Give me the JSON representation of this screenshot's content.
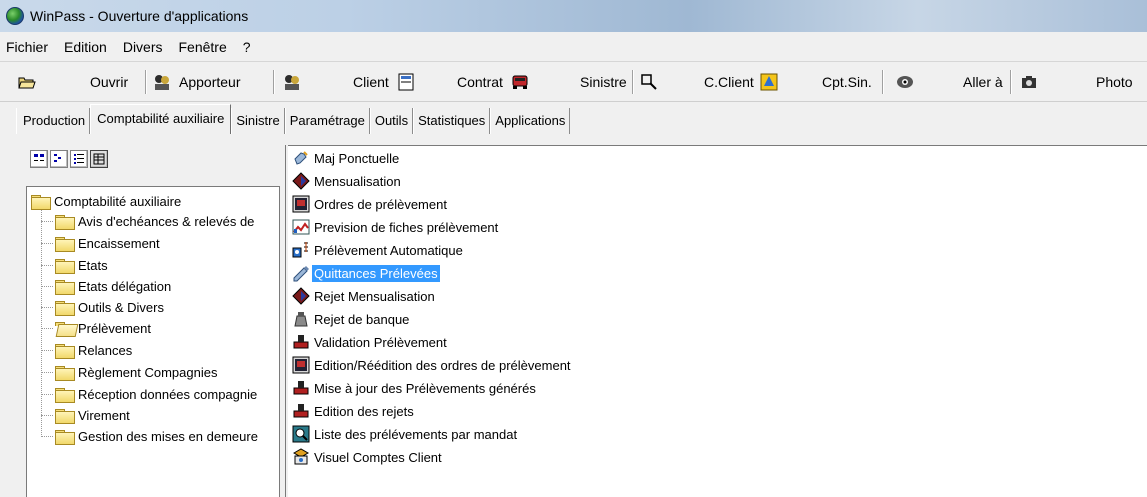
{
  "window": {
    "title": "WinPass - Ouverture d'applications"
  },
  "menu": [
    "Fichier",
    "Edition",
    "Divers",
    "Fenêtre",
    "?"
  ],
  "toolbar": {
    "ouvrir": "Ouvrir",
    "apporteur": "Apporteur",
    "client": "Client",
    "contrat": "Contrat",
    "sinistre": "Sinistre",
    "cclient": "C.Client",
    "cptsin": "Cpt.Sin.",
    "aller": "Aller à",
    "photo": "Photo"
  },
  "tabs": [
    "Production",
    "Comptabilité auxiliaire",
    "Sinistre",
    "Paramétrage",
    "Outils",
    "Statistiques",
    "Applications"
  ],
  "active_tab": "Comptabilité auxiliaire",
  "tree": {
    "root": "Comptabilité auxiliaire",
    "items": [
      "Avis d'echéances & relevés de",
      "Encaissement",
      "Etats",
      "Etats délégation",
      "Outils & Divers",
      "Prélèvement",
      "Relances",
      "Règlement Compagnies",
      "Réception données compagnie",
      "Virement",
      "Gestion des mises en demeure"
    ],
    "open_item": "Prélèvement"
  },
  "list": {
    "items": [
      "Maj Ponctuelle",
      "Mensualisation",
      "Ordres de prélèvement",
      "Prevision de fiches  prélèvement",
      "Prélèvement Automatique",
      "Quittances Prélevées",
      "Rejet Mensualisation",
      "Rejet de banque",
      "Validation Prélèvement",
      "Edition/Réédition des ordres de prélèvement",
      "Mise à jour des Prélèvements générés",
      "Edition des rejets",
      "Liste des prélévements par mandat",
      "Visuel Comptes Client"
    ],
    "selected_item": "Quittances Prélevées"
  },
  "colors": {
    "selection": "#3399ff",
    "titlebar": "#bcd0e6"
  }
}
